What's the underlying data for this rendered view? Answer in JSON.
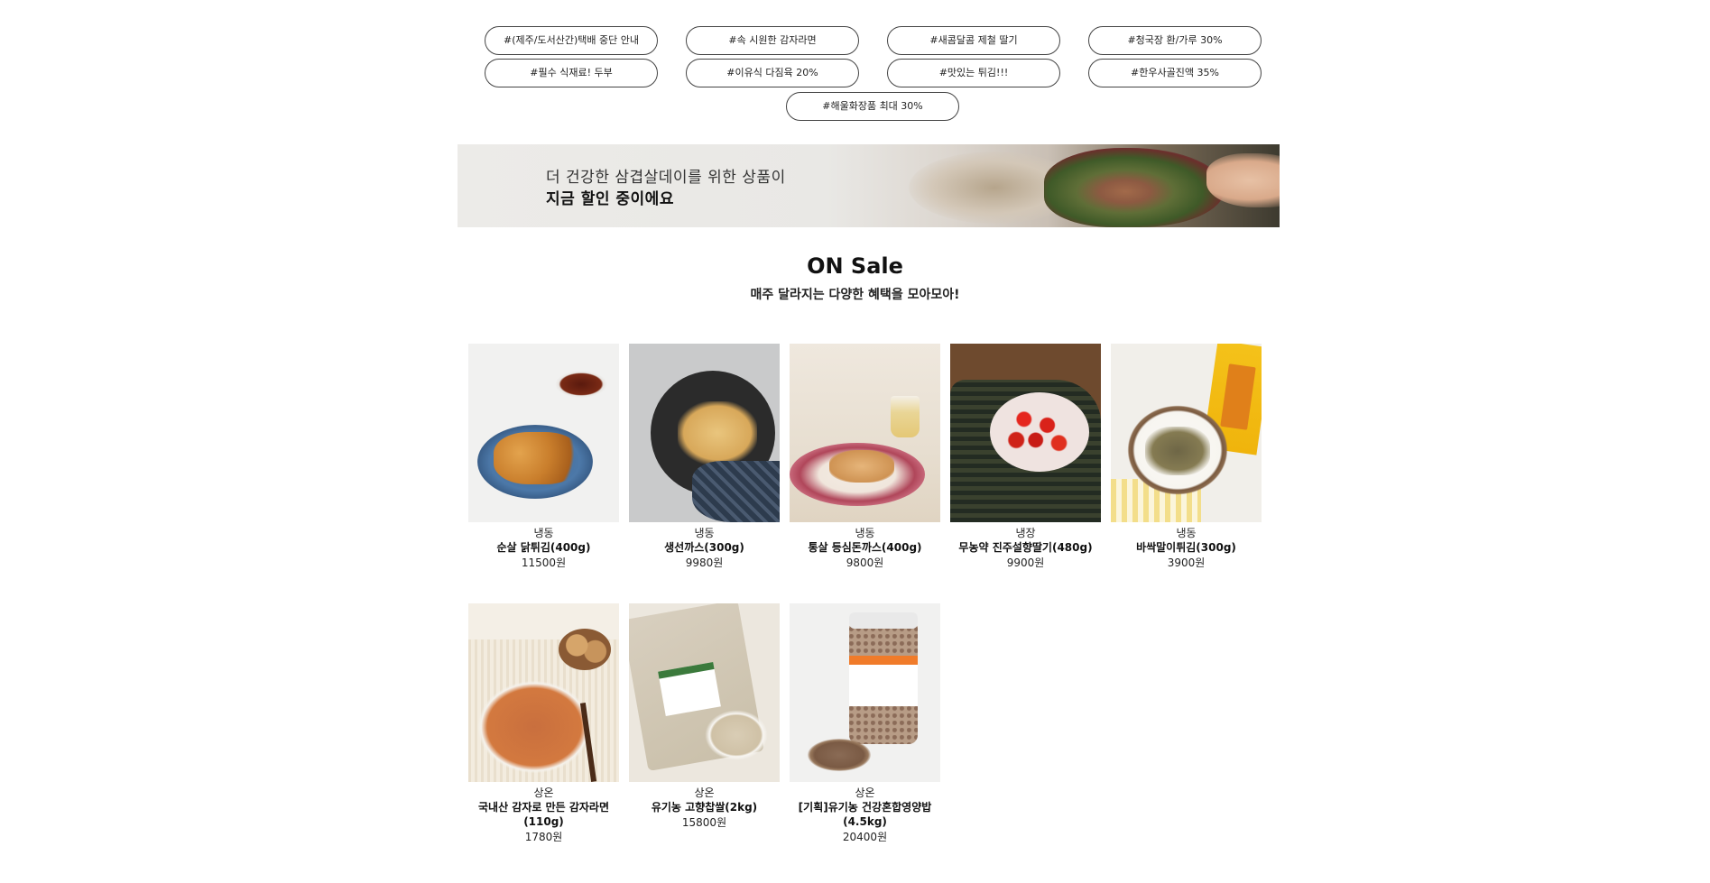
{
  "tags": [
    "#(제주/도서산간)택배 중단 안내",
    "#속 시원한 감자라면",
    "#새콤달콤 제철 딸기",
    "#청국장 환/가루 30%",
    "#필수 식재료! 두부",
    "#이유식 다짐육 20%",
    "#맛있는 튀김!!!",
    "#한우사골진액 35%",
    "#해울화장품 최대 30%"
  ],
  "banner": {
    "line1": "더 건강한 삼겹살데이를 위한 상품이",
    "line2": "지금 할인 중이에요"
  },
  "section": {
    "title": "ON Sale",
    "subtitle": "매주 달라지는 다양한 혜택을 모아모아!"
  },
  "products": [
    {
      "category": "냉동",
      "name": "순살 닭튀김(400g)",
      "price": "11500원"
    },
    {
      "category": "냉동",
      "name": "생선까스(300g)",
      "price": "9980원"
    },
    {
      "category": "냉동",
      "name": "통살 등심돈까스(400g)",
      "price": "9800원"
    },
    {
      "category": "냉장",
      "name": "무농약 진주설향딸기(480g)",
      "price": "9900원"
    },
    {
      "category": "냉동",
      "name": "바싹말이튀김(300g)",
      "price": "3900원"
    },
    {
      "category": "상온",
      "name": "국내산 감자로 만든 감자라면(110g)",
      "price": "1780원"
    },
    {
      "category": "상온",
      "name": "유기농 고향찹쌀(2kg)",
      "price": "15800원"
    },
    {
      "category": "상온",
      "name": "[기획]유기농 건강혼합영양밥(4.5kg)",
      "price": "20400원"
    }
  ]
}
